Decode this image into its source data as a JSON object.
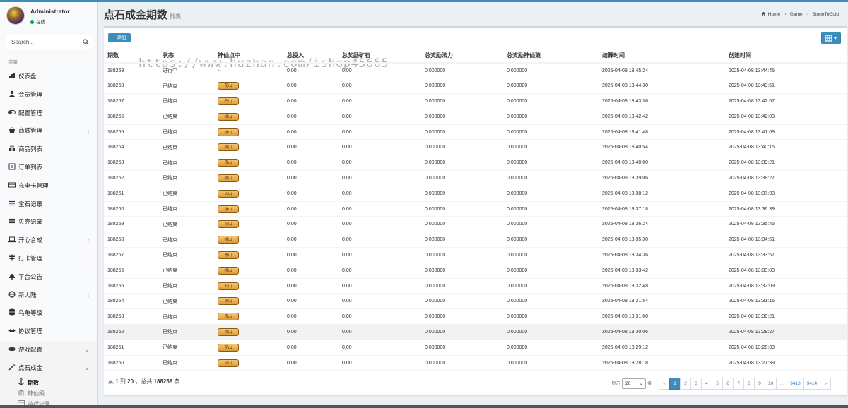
{
  "user": {
    "name": "Administrator",
    "status": "在线"
  },
  "search": {
    "placeholder": "Search..."
  },
  "menu": {
    "header": "菜单",
    "items": [
      {
        "label": "仪表盘",
        "icon": "dashboard-icon",
        "caret": false
      },
      {
        "label": "会员管理",
        "icon": "user-icon",
        "caret": false
      },
      {
        "label": "配置管理",
        "icon": "toggle-icon",
        "caret": false
      },
      {
        "label": "商城管理",
        "icon": "shop-icon",
        "caret": true
      },
      {
        "label": "商品列表",
        "icon": "gift-icon",
        "caret": false
      },
      {
        "label": "订单列表",
        "icon": "order-icon",
        "caret": false
      },
      {
        "label": "充电卡管理",
        "icon": "card-icon",
        "caret": false
      },
      {
        "label": "宝石记录",
        "icon": "list-icon",
        "caret": false
      },
      {
        "label": "贝壳记录",
        "icon": "list-icon",
        "caret": false
      },
      {
        "label": "开心合成",
        "icon": "laptop-icon",
        "caret": true
      },
      {
        "label": "打卡管理",
        "icon": "sign-icon",
        "caret": true
      },
      {
        "label": "平台公告",
        "icon": "bell-icon",
        "caret": false
      },
      {
        "label": "新大陆",
        "icon": "globe-icon",
        "caret": true
      },
      {
        "label": "乌龟等级",
        "icon": "database-icon",
        "caret": false
      },
      {
        "label": "协议管理",
        "icon": "handshake-icon",
        "caret": false
      },
      {
        "label": "游戏配置",
        "icon": "gamepad-icon",
        "caret": true
      },
      {
        "label": "点石成金",
        "icon": "wand-icon",
        "caret": true
      }
    ],
    "submenu": [
      {
        "label": "期数",
        "icon": "anchor-icon",
        "active": true
      },
      {
        "label": "神仙殿",
        "icon": "temple-icon",
        "active": false
      },
      {
        "label": "游戏记录",
        "icon": "record-icon",
        "active": false
      }
    ]
  },
  "page": {
    "title": "点石成金期数",
    "subtitle": "列表"
  },
  "breadcrumb": [
    "Home",
    "Game",
    "StoneToGold"
  ],
  "toolbar": {
    "add_label": "+ 添加"
  },
  "watermark": "https://www.huzhan.com/ishop45665",
  "table": {
    "headers": [
      "期数",
      "状态",
      "神仙点中",
      "总投入",
      "总奖励矿石",
      "总奖励法力",
      "总奖励神仙猿",
      "结算时间",
      "创建时间"
    ],
    "rows": [
      [
        "188269",
        "进行中",
        "--",
        "0.00",
        "0.00",
        "0.000000",
        "0.000000",
        "2025-04-08 13:45:24",
        "2025-04-08 13:44:45"
      ],
      [
        "188268",
        "已结束",
        "花山",
        "0.00",
        "0.00",
        "0.000000",
        "0.000000",
        "2025-04-08 13:44:30",
        "2025-04-08 13:43:51"
      ],
      [
        "188267",
        "已结束",
        "石山",
        "0.00",
        "0.00",
        "0.000000",
        "0.000000",
        "2025-04-08 13:43:36",
        "2025-04-08 13:42:57"
      ],
      [
        "188266",
        "已结束",
        "桃山",
        "0.00",
        "0.00",
        "0.000000",
        "0.000000",
        "2025-04-08 13:42:42",
        "2025-04-08 13:42:03"
      ],
      [
        "188265",
        "已结束",
        "冰山",
        "0.00",
        "0.00",
        "0.000000",
        "0.000000",
        "2025-04-08 13:41:48",
        "2025-04-08 13:41:09"
      ],
      [
        "188264",
        "已结束",
        "桃山",
        "0.00",
        "0.00",
        "0.000000",
        "0.000000",
        "2025-04-08 13:40:54",
        "2025-04-08 13:40:15"
      ],
      [
        "188263",
        "已结束",
        "青山",
        "0.00",
        "0.00",
        "0.000000",
        "0.000000",
        "2025-04-08 13:40:00",
        "2025-04-08 13:39:21"
      ],
      [
        "188262",
        "已结束",
        "桃山",
        "0.00",
        "0.00",
        "0.000000",
        "0.000000",
        "2025-04-08 13:39:06",
        "2025-04-08 13:38:27"
      ],
      [
        "188261",
        "已结束",
        "火山",
        "0.00",
        "0.00",
        "0.000000",
        "0.000000",
        "2025-04-08 13:38:12",
        "2025-04-08 13:37:33"
      ],
      [
        "188260",
        "已结束",
        "冰山",
        "0.00",
        "0.00",
        "0.000000",
        "0.000000",
        "2025-04-08 13:37:18",
        "2025-04-08 13:36:39"
      ],
      [
        "188259",
        "已结束",
        "花山",
        "0.00",
        "0.00",
        "0.000000",
        "0.000000",
        "2025-04-08 13:36:24",
        "2025-04-08 13:35:45"
      ],
      [
        "188258",
        "已结束",
        "桃山",
        "0.00",
        "0.00",
        "0.000000",
        "0.000000",
        "2025-04-08 13:35:30",
        "2025-04-08 13:34:51"
      ],
      [
        "188257",
        "已结束",
        "青山",
        "0.00",
        "0.00",
        "0.000000",
        "0.000000",
        "2025-04-08 13:34:36",
        "2025-04-08 13:33:57"
      ],
      [
        "188256",
        "已结束",
        "桃山",
        "0.00",
        "0.00",
        "0.000000",
        "0.000000",
        "2025-04-08 13:33:42",
        "2025-04-08 13:33:03"
      ],
      [
        "188255",
        "已结束",
        "石山",
        "0.00",
        "0.00",
        "0.000000",
        "0.000000",
        "2025-04-08 13:32:48",
        "2025-04-08 13:32:09"
      ],
      [
        "188254",
        "已结束",
        "冰山",
        "0.00",
        "0.00",
        "0.000000",
        "0.000000",
        "2025-04-08 13:31:54",
        "2025-04-08 13:31:15"
      ],
      [
        "188253",
        "已结束",
        "青山",
        "0.00",
        "0.00",
        "0.000000",
        "0.000000",
        "2025-04-08 13:31:00",
        "2025-04-08 13:30:21"
      ],
      [
        "188252",
        "已结束",
        "桃山",
        "0.00",
        "0.00",
        "0.000000",
        "0.000000",
        "2025-04-08 13:30:06",
        "2025-04-08 13:29:27"
      ],
      [
        "188251",
        "已结束",
        "花山",
        "0.00",
        "0.00",
        "0.000000",
        "0.000000",
        "2025-04-08 13:29:12",
        "2025-04-08 13:28:33"
      ],
      [
        "188250",
        "已结束",
        "火山",
        "0.00",
        "0.00",
        "0.000000",
        "0.000000",
        "2025-04-08 13:28:18",
        "2025-04-08 13:27:39"
      ]
    ],
    "highlight_row": 17
  },
  "footer": {
    "info_prefix": "从",
    "from": "1",
    "to_word": "到",
    "to": "20",
    "total_word": "，总共",
    "total": "188268",
    "unit": "条",
    "per_page_prefix": "显示",
    "per_page_value": "20",
    "per_page_suffix": "条"
  },
  "pagination": [
    "«",
    "1",
    "2",
    "3",
    "4",
    "5",
    "6",
    "7",
    "8",
    "9",
    "10",
    "...",
    "9413",
    "9414",
    "»"
  ],
  "colors": {
    "accent": "#3c8dbc",
    "tag_fill": "#e8ac50",
    "online": "#00a65a"
  }
}
